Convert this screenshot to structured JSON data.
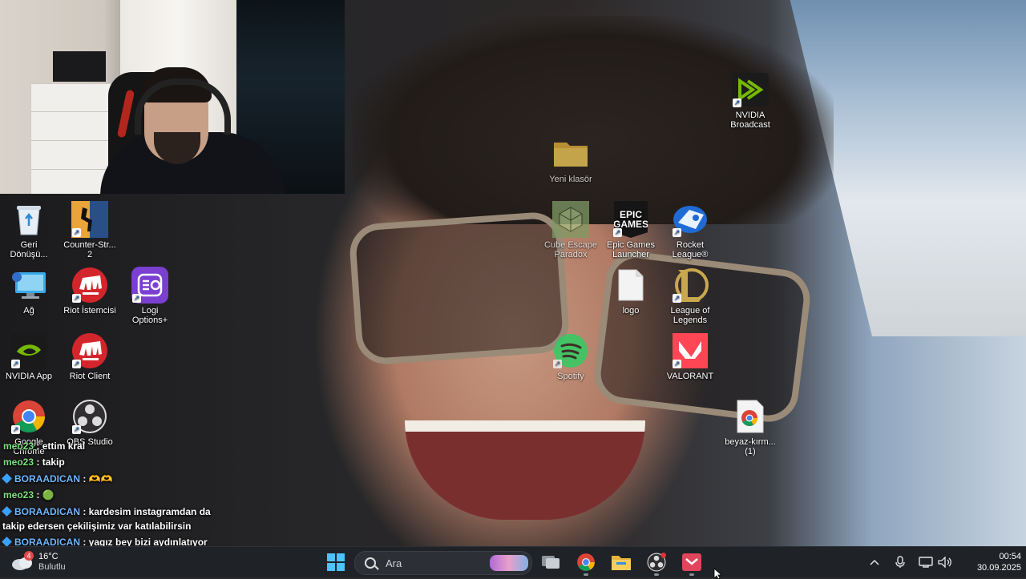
{
  "desktop_icons": [
    {
      "id": "recycle-bin",
      "label": "Geri\nDönüşü...",
      "icon": "recycle-bin-icon"
    },
    {
      "id": "counter-strike",
      "label": "Counter-Str...\n2",
      "icon": "counter-strike-icon"
    },
    {
      "id": "network",
      "label": "Ağ",
      "icon": "network-icon"
    },
    {
      "id": "riot-istemcisi",
      "label": "Riot İstemcisi",
      "icon": "riot-icon"
    },
    {
      "id": "logi-options",
      "label": "Logi\nOptions+",
      "icon": "logi-options-icon"
    },
    {
      "id": "nvidia-app",
      "label": "NVIDIA App",
      "icon": "nvidia-icon"
    },
    {
      "id": "riot-client",
      "label": "Riot Client",
      "icon": "riot-icon"
    },
    {
      "id": "google-chrome",
      "label": "Google\nChrome",
      "icon": "chrome-icon"
    },
    {
      "id": "obs-studio",
      "label": "OBS Studio",
      "icon": "obs-icon"
    },
    {
      "id": "yeni-klasor",
      "label": "Yeni klasör",
      "icon": "folder-icon"
    },
    {
      "id": "cube-escape",
      "label": "Cube Escape\nParadox",
      "icon": "cube-escape-icon"
    },
    {
      "id": "epic-games",
      "label": "Epic Games\nLauncher",
      "icon": "epic-games-icon",
      "icon_text": "EPIC\nGAMES"
    },
    {
      "id": "rocket-league",
      "label": "Rocket\nLeague®",
      "icon": "rocket-league-icon"
    },
    {
      "id": "logo",
      "label": "logo",
      "icon": "file-icon"
    },
    {
      "id": "league-of-legends",
      "label": "League of\nLegends",
      "icon": "league-of-legends-icon"
    },
    {
      "id": "spotify",
      "label": "Spotify",
      "icon": "spotify-icon"
    },
    {
      "id": "valorant",
      "label": "VALORANT",
      "icon": "valorant-icon"
    },
    {
      "id": "nvidia-broadcast",
      "label": "NVIDIA\nBroadcast",
      "icon": "nvidia-broadcast-icon"
    },
    {
      "id": "beyaz-kirmizi",
      "label": "beyaz-kırm...\n(1)",
      "icon": "chrome-file-icon"
    }
  ],
  "chat": [
    {
      "user": "meo23",
      "text": "ettim kral",
      "color": "#7be37b",
      "badge": false
    },
    {
      "user": "meo23",
      "text": "takip",
      "color": "#7be37b",
      "badge": false
    },
    {
      "user": "BORAADICAN",
      "text": "🫶🫶",
      "color": "#6fb7ff",
      "badge": true
    },
    {
      "user": "meo23",
      "text": "🟢",
      "color": "#7be37b",
      "badge": false
    },
    {
      "user": "BORAADICAN",
      "text": "kardesim instagramdan da",
      "color": "#6fb7ff",
      "badge": true
    },
    {
      "user": "",
      "text": "takip edersen çekilişimiz var katılabilirsin",
      "color": "",
      "badge": false
    },
    {
      "user": "BORAADICAN",
      "text": "yagız bey bizi aydınlatıyor",
      "color": "#6fb7ff",
      "badge": true
    }
  ],
  "chat_separator": " : ",
  "taskbar": {
    "weather_temp": "16°C",
    "weather_desc": "Bulutlu",
    "weather_badge": "4",
    "search_placeholder": "Ara",
    "time": "00:54",
    "date": "30.09.2025",
    "apps": [
      "windows-start-icon",
      "search-box",
      "task-view-icon",
      "chrome-icon",
      "file-explorer-icon",
      "obs-icon",
      "app-icon"
    ]
  },
  "colors": {
    "taskbar_bg": "#1f2226",
    "chat_green": "#7be37b",
    "chat_blue": "#6fb7ff"
  }
}
